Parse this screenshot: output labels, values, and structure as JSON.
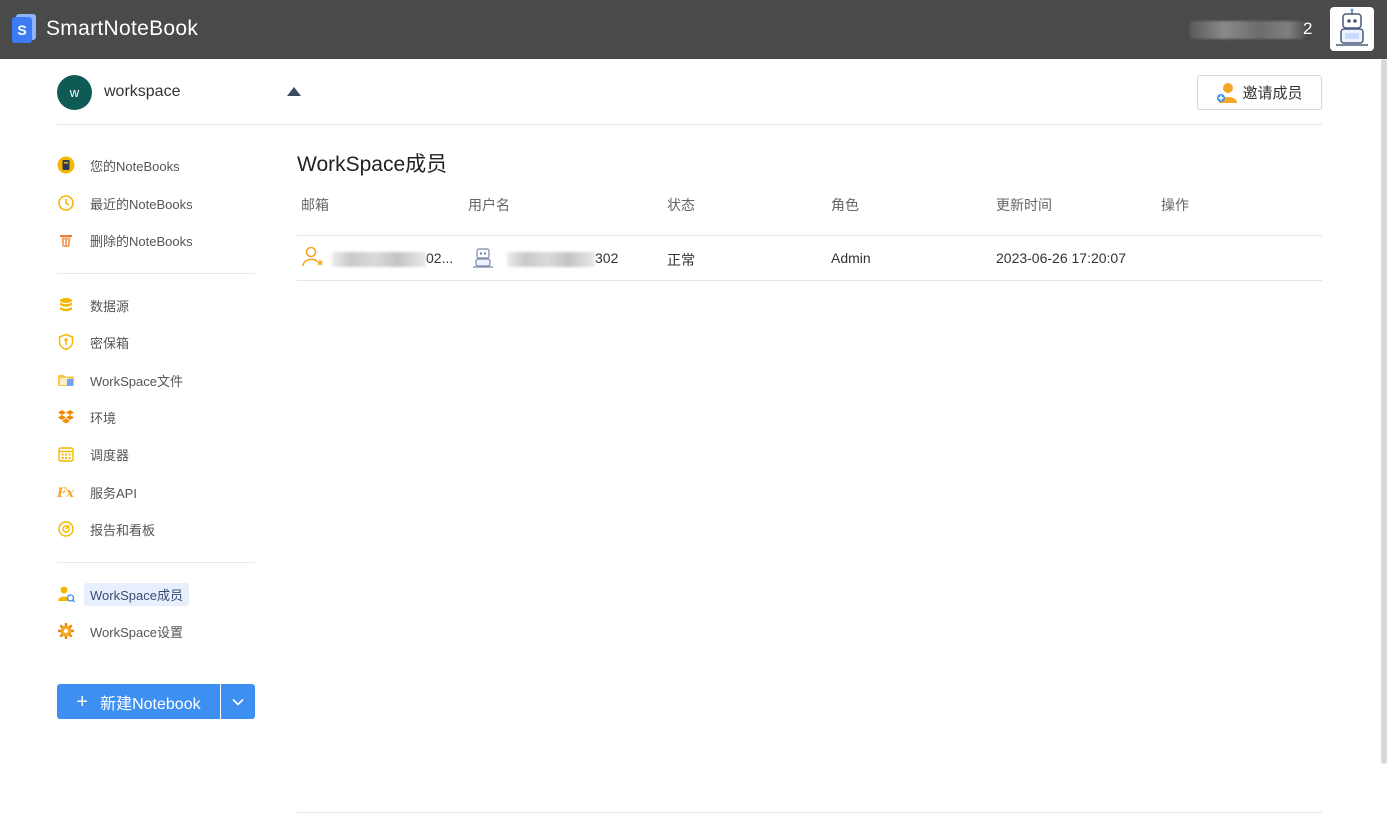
{
  "app": {
    "title": "SmartNoteBook",
    "logo_letter": "S",
    "user_suffix": "2"
  },
  "workspace": {
    "avatar_letter": "w",
    "name": "workspace",
    "invite_label": "邀请成员"
  },
  "sidebar": {
    "group1": [
      {
        "label": "您的NoteBooks",
        "icon": "notebook-icon"
      },
      {
        "label": "最近的NoteBooks",
        "icon": "clock-icon"
      },
      {
        "label": "删除的NoteBooks",
        "icon": "trash-icon"
      }
    ],
    "group2": [
      {
        "label": "数据源",
        "icon": "database-icon"
      },
      {
        "label": "密保箱",
        "icon": "shield-icon"
      },
      {
        "label": "WorkSpace文件",
        "icon": "folder-icon"
      },
      {
        "label": "环境",
        "icon": "dropbox-icon"
      },
      {
        "label": "调度器",
        "icon": "calendar-icon"
      },
      {
        "label": "服务API",
        "icon": "fx-icon"
      },
      {
        "label": "报告和看板",
        "icon": "dashboard-icon"
      }
    ],
    "group3": [
      {
        "label": "WorkSpace成员",
        "icon": "member-icon",
        "active": true
      },
      {
        "label": "WorkSpace设置",
        "icon": "settings-icon"
      }
    ],
    "new_button_label": "新建Notebook"
  },
  "main": {
    "title": "WorkSpace成员",
    "columns": [
      "邮箱",
      "用户名",
      "状态",
      "角色",
      "更新时间",
      "操作"
    ],
    "rows": [
      {
        "email_visible": "02...",
        "username_visible": "302",
        "status": "正常",
        "role": "Admin",
        "updated": "2023-06-26 17:20:07"
      }
    ]
  },
  "colors": {
    "topbar": "#4a4a4a",
    "accent": "#3d8ff2",
    "icon_orange": "#f5a623",
    "workspace_avatar": "#0e5a55"
  }
}
